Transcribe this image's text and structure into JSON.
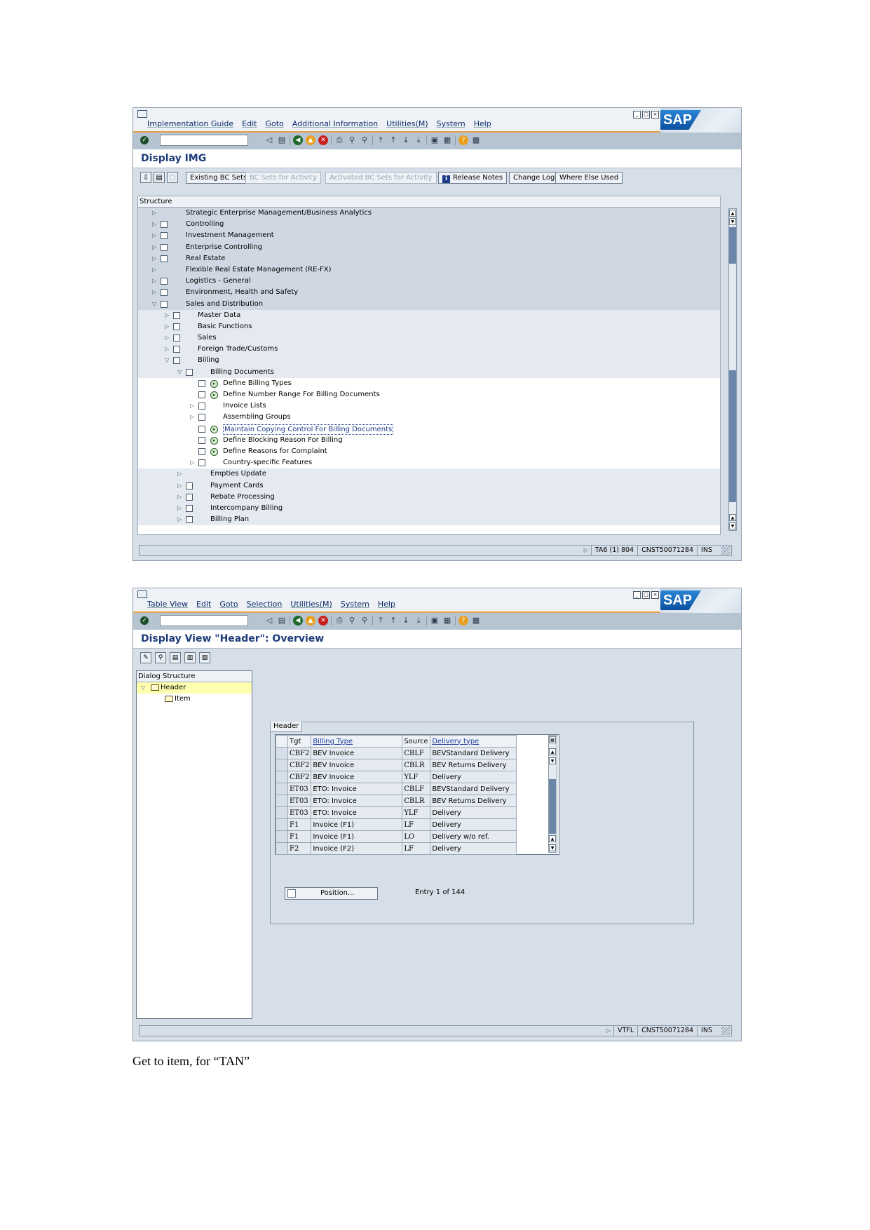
{
  "window1": {
    "menu": [
      "Implementation Guide",
      "Edit",
      "Goto",
      "Additional Information",
      "Utilities(M)",
      "System",
      "Help"
    ],
    "title": "Display IMG",
    "app_buttons": {
      "existing_bc_sets": "Existing BC Sets",
      "bc_sets_for_activity": "BC Sets for Activity",
      "activated_bc_sets": "Activated BC Sets for Activity",
      "release_notes": "Release Notes",
      "change_log": "Change Log",
      "where_else_used": "Where Else Used"
    },
    "tree_header": "Structure",
    "tree": [
      {
        "label": "Strategic Enterprise Management/Business Analytics",
        "level": 0,
        "exp": "closed",
        "doc": false,
        "clock": false,
        "shade": "shade"
      },
      {
        "label": "Controlling",
        "level": 0,
        "exp": "closed",
        "doc": true,
        "clock": false,
        "shade": "shade"
      },
      {
        "label": "Investment Management",
        "level": 0,
        "exp": "closed",
        "doc": true,
        "clock": false,
        "shade": "shade"
      },
      {
        "label": "Enterprise Controlling",
        "level": 0,
        "exp": "closed",
        "doc": true,
        "clock": false,
        "shade": "shade"
      },
      {
        "label": "Real Estate",
        "level": 0,
        "exp": "closed",
        "doc": true,
        "clock": false,
        "shade": "shade"
      },
      {
        "label": "Flexible Real Estate Management (RE-FX)",
        "level": 0,
        "exp": "closed",
        "doc": false,
        "clock": false,
        "shade": "shade"
      },
      {
        "label": "Logistics - General",
        "level": 0,
        "exp": "closed",
        "doc": true,
        "clock": false,
        "shade": "shade"
      },
      {
        "label": "Environment, Health and Safety",
        "level": 0,
        "exp": "closed",
        "doc": true,
        "clock": false,
        "shade": "shade"
      },
      {
        "label": "Sales and Distribution",
        "level": 0,
        "exp": "open",
        "doc": true,
        "clock": false,
        "shade": "shade"
      },
      {
        "label": "Master Data",
        "level": 1,
        "exp": "closed",
        "doc": true,
        "clock": false,
        "shade": "light"
      },
      {
        "label": "Basic Functions",
        "level": 1,
        "exp": "closed",
        "doc": true,
        "clock": false,
        "shade": "light"
      },
      {
        "label": "Sales",
        "level": 1,
        "exp": "closed",
        "doc": true,
        "clock": false,
        "shade": "light"
      },
      {
        "label": "Foreign Trade/Customs",
        "level": 1,
        "exp": "closed",
        "doc": true,
        "clock": false,
        "shade": "light"
      },
      {
        "label": "Billing",
        "level": 1,
        "exp": "open",
        "doc": true,
        "clock": false,
        "shade": "light"
      },
      {
        "label": "Billing Documents",
        "level": 2,
        "exp": "open",
        "doc": true,
        "clock": false,
        "shade": "light"
      },
      {
        "label": "Define Billing Types",
        "level": 3,
        "exp": "none",
        "doc": true,
        "clock": true,
        "shade": ""
      },
      {
        "label": "Define Number Range For Billing Documents",
        "level": 3,
        "exp": "none",
        "doc": true,
        "clock": true,
        "shade": ""
      },
      {
        "label": "Invoice Lists",
        "level": 3,
        "exp": "closed",
        "doc": true,
        "clock": false,
        "shade": ""
      },
      {
        "label": "Assembling Groups",
        "level": 3,
        "exp": "closed",
        "doc": true,
        "clock": false,
        "shade": ""
      },
      {
        "label": "Maintain Copying Control For Billing Documents",
        "level": 3,
        "exp": "none",
        "doc": true,
        "clock": true,
        "shade": "",
        "focus": true
      },
      {
        "label": "Define Blocking Reason For Billing",
        "level": 3,
        "exp": "none",
        "doc": true,
        "clock": true,
        "shade": ""
      },
      {
        "label": "Define Reasons for Complaint",
        "level": 3,
        "exp": "none",
        "doc": true,
        "clock": true,
        "shade": ""
      },
      {
        "label": "Country-specific Features",
        "level": 3,
        "exp": "closed",
        "doc": true,
        "clock": false,
        "shade": ""
      },
      {
        "label": "Empties Update",
        "level": 2,
        "exp": "closed",
        "doc": false,
        "clock": false,
        "shade": "light"
      },
      {
        "label": "Payment Cards",
        "level": 2,
        "exp": "closed",
        "doc": true,
        "clock": false,
        "shade": "light"
      },
      {
        "label": "Rebate Processing",
        "level": 2,
        "exp": "closed",
        "doc": true,
        "clock": false,
        "shade": "light"
      },
      {
        "label": "Intercompany Billing",
        "level": 2,
        "exp": "closed",
        "doc": true,
        "clock": false,
        "shade": "light"
      },
      {
        "label": "Billing Plan",
        "level": 2,
        "exp": "closed",
        "doc": true,
        "clock": false,
        "shade": "light"
      }
    ],
    "status": {
      "transaction": "TA6 (1) 804",
      "server": "CNST50071284",
      "mode": "INS"
    }
  },
  "window2": {
    "menu": [
      "Table View",
      "Edit",
      "Goto",
      "Selection",
      "Utilities(M)",
      "System",
      "Help"
    ],
    "title": "Display View \"Header\": Overview",
    "dialog_structure": {
      "header": "Dialog Structure",
      "node_header": "Header",
      "node_item": "Item"
    },
    "tab_title": "Header",
    "table": {
      "columns": [
        "Tgt",
        "Billing Type",
        "Source",
        "Delivery type"
      ],
      "rows": [
        [
          "CBF2",
          "BEV Invoice",
          "CBLF",
          "BEVStandard Delivery"
        ],
        [
          "CBF2",
          "BEV Invoice",
          "CBLR",
          "BEV Returns Delivery"
        ],
        [
          "CBF2",
          "BEV Invoice",
          "YLF",
          "Delivery"
        ],
        [
          "ET03",
          "ETO: Invoice",
          "CBLF",
          "BEVStandard Delivery"
        ],
        [
          "ET03",
          "ETO: Invoice",
          "CBLR",
          "BEV Returns Delivery"
        ],
        [
          "ET03",
          "ETO: Invoice",
          "YLF",
          "Delivery"
        ],
        [
          "F1",
          "Invoice (F1)",
          "LF",
          "Delivery"
        ],
        [
          "F1",
          "Invoice (F1)",
          "LO",
          "Delivery w/o ref."
        ],
        [
          "F2",
          "Invoice (F2)",
          "LF",
          "Delivery"
        ]
      ]
    },
    "position_button": "Position...",
    "entry_info": "Entry 1 of 144",
    "status": {
      "transaction": "VTFL",
      "server": "CNST50071284",
      "mode": "INS"
    }
  },
  "caption": "Get to item, for “TAN”",
  "logo_text": "SAP",
  "colors": {
    "accent_orange": "#e8a04a",
    "title_blue": "#1d3c7a",
    "frame": "#d6dee8"
  }
}
